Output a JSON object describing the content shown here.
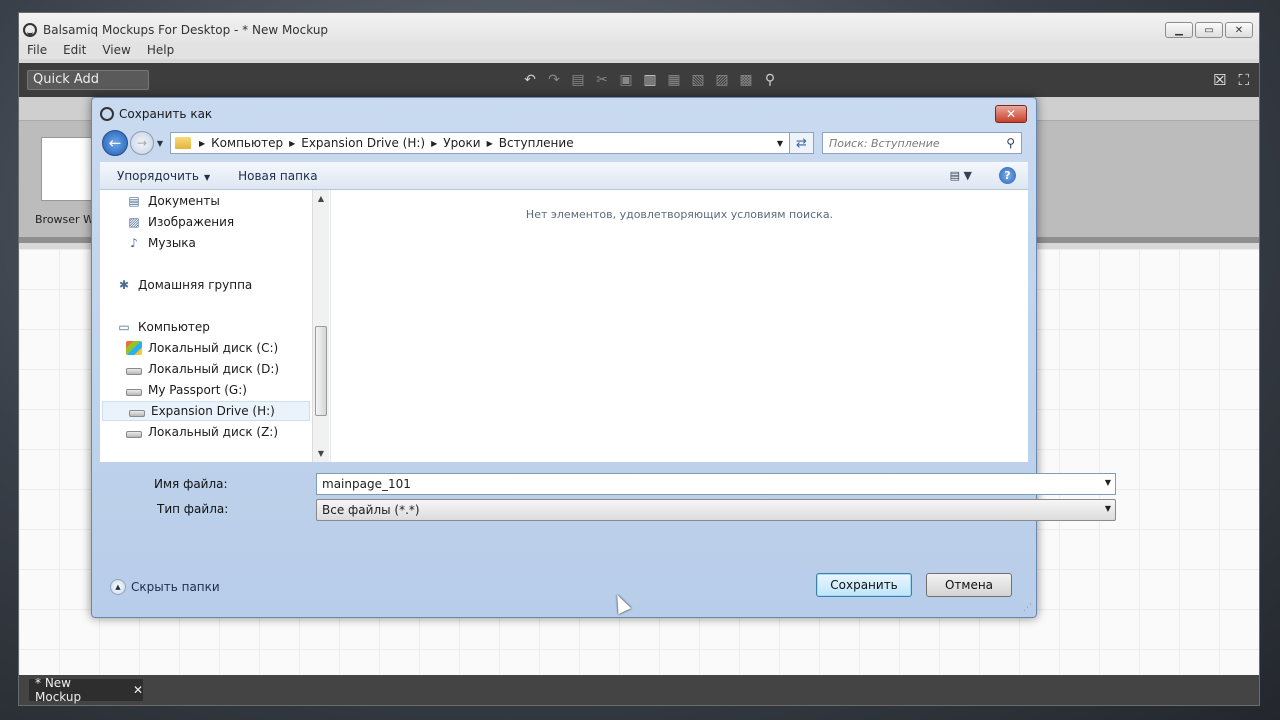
{
  "app": {
    "title": "Balsamiq Mockups For Desktop - * New Mockup",
    "menu": [
      "File",
      "Edit",
      "View",
      "Help"
    ],
    "quick_add": "Quick Add",
    "library_item_label": "Browser W",
    "mockup_tab": "* New Mockup"
  },
  "dialog": {
    "title": "Сохранить как",
    "breadcrumbs": [
      "Компьютер",
      "Expansion Drive (H:)",
      "Уроки",
      "Вступление"
    ],
    "search_placeholder": "Поиск: Вступление",
    "commands": {
      "organize": "Упорядочить",
      "new_folder": "Новая папка"
    },
    "tree": [
      {
        "label": "Документы",
        "icon": "documents-icon"
      },
      {
        "label": "Изображения",
        "icon": "pictures-icon"
      },
      {
        "label": "Музыка",
        "icon": "music-icon"
      },
      {
        "label": "Домашняя группа",
        "icon": "homegroup-icon"
      },
      {
        "label": "Компьютер",
        "icon": "computer-icon"
      },
      {
        "label": "Локальный диск (C:)",
        "icon": "system-drive-icon"
      },
      {
        "label": "Локальный диск (D:)",
        "icon": "drive-icon"
      },
      {
        "label": "My Passport (G:)",
        "icon": "drive-icon"
      },
      {
        "label": "Expansion Drive (H:)",
        "icon": "drive-icon",
        "selected": true
      },
      {
        "label": "Локальный диск (Z:)",
        "icon": "drive-icon"
      }
    ],
    "empty_message": "Нет элементов, удовлетворяющих условиям поиска.",
    "filename_label": "Имя файла:",
    "filename_value": "mainpage_101",
    "filetype_label": "Тип файла:",
    "filetype_value": "Все файлы (*.*)",
    "hide_folders": "Скрыть папки",
    "save_button": "Сохранить",
    "cancel_button": "Отмена"
  },
  "colors": {
    "dialog_frame": "#b8cde9",
    "toolbar": "#3d3d3d",
    "close_button": "#c9402c"
  }
}
